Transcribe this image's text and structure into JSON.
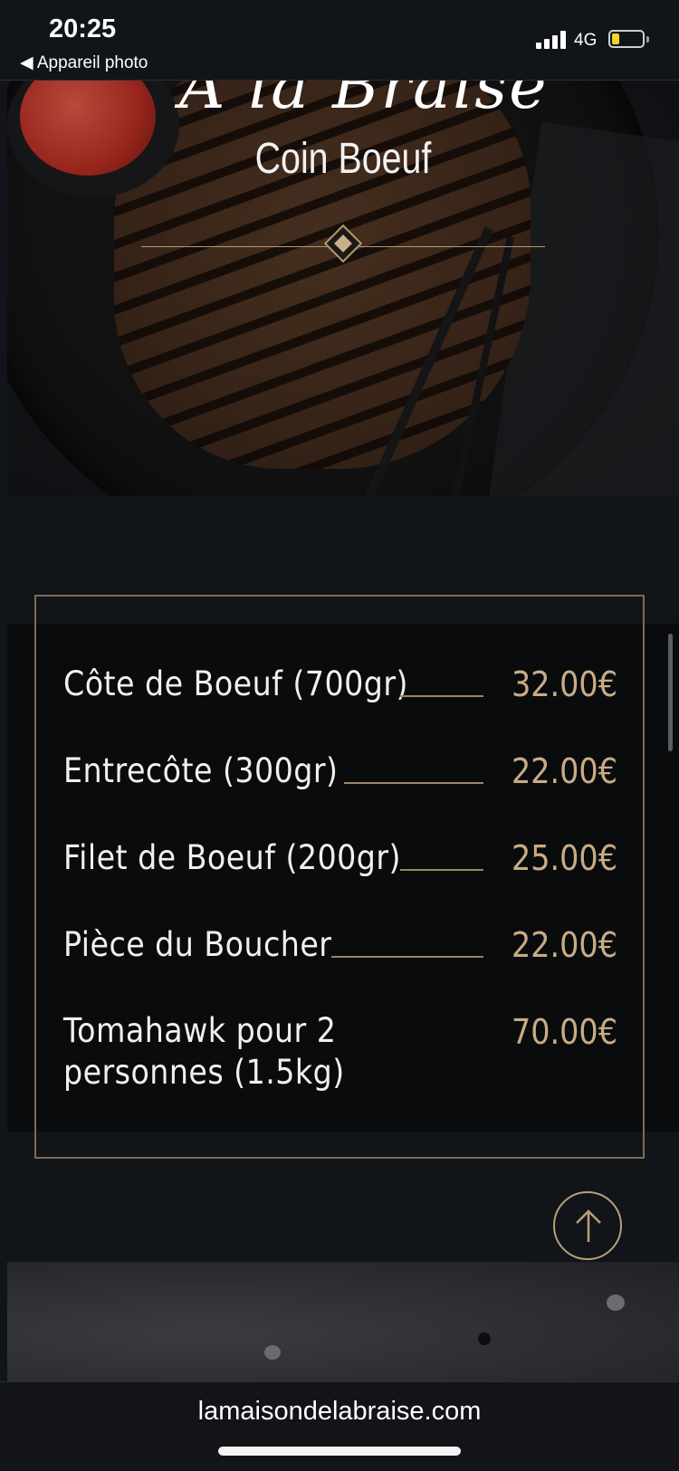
{
  "status_bar": {
    "time": "20:25",
    "back_label": "◀ Appareil photo",
    "network": "4G"
  },
  "hero": {
    "partial_title": "A la Braise",
    "subtitle": "Coin Boeuf"
  },
  "menu": {
    "items": [
      {
        "name": "Côte de Boeuf (700gr)",
        "price": "32.00€"
      },
      {
        "name": "Entrecôte (300gr)",
        "price": "22.00€"
      },
      {
        "name": "Filet de Boeuf (200gr)",
        "price": "25.00€"
      },
      {
        "name": "Pièce du Boucher",
        "price": "22.00€"
      },
      {
        "name": "Tomahawk pour 2 personnes (1.5kg)",
        "price": "70.00€"
      }
    ]
  },
  "browser": {
    "url": "lamaisondelabraise.com"
  },
  "colors": {
    "background": "#111419",
    "accent_gold": "#c8ac86",
    "frame_border": "#7d6b55"
  }
}
